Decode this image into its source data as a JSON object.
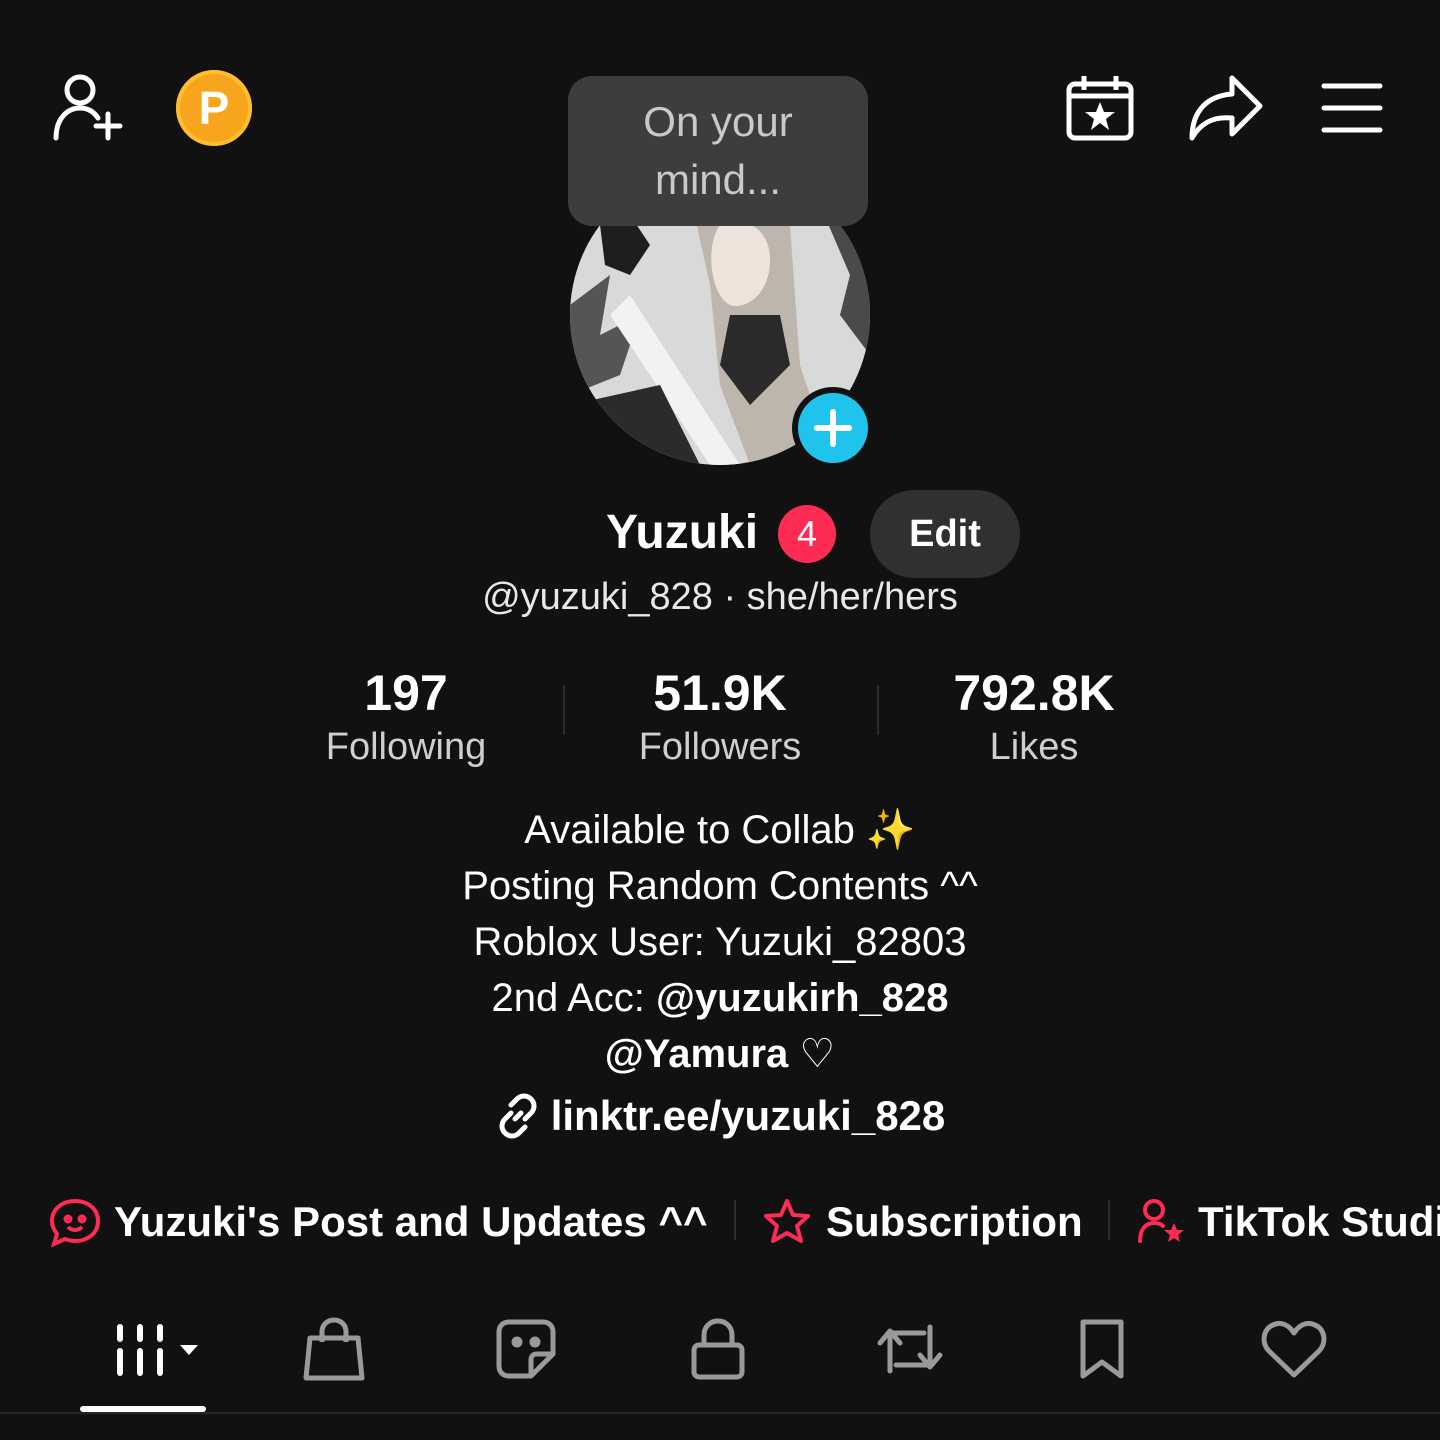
{
  "header": {
    "coin_letter": "P",
    "bubble_text": "On your mind..."
  },
  "profile": {
    "display_name": "Yuzuki",
    "badge_count": "4",
    "edit_label": "Edit",
    "handle_line": "@yuzuki_828 · she/her/hers"
  },
  "stats": [
    {
      "value": "197",
      "label": "Following"
    },
    {
      "value": "51.9K",
      "label": "Followers"
    },
    {
      "value": "792.8K",
      "label": "Likes"
    }
  ],
  "bio": {
    "line1": "Available to Collab ✨",
    "line2": "Posting Random Contents ^^",
    "line3": "Roblox User: Yuzuki_82803",
    "line4_prefix": "2nd Acc: ",
    "line4_mention": "@yuzukirh_828",
    "line5_mention": "@Yamura",
    "line5_suffix": " ♡",
    "link": "linktr.ee/yuzuki_828"
  },
  "chips": [
    {
      "label": "Yuzuki's Post and Updates ^^",
      "icon": "chat-bubble-icon"
    },
    {
      "label": "Subscription",
      "icon": "star-icon"
    },
    {
      "label": "TikTok Studi",
      "icon": "person-star-icon"
    }
  ],
  "tabs": [
    "grid-icon",
    "shopping-bag-icon",
    "sticker-icon",
    "lock-icon",
    "repost-icon",
    "bookmark-icon",
    "heart-icon"
  ],
  "colors": {
    "background": "#111111",
    "accent_red": "#fe2c55",
    "accent_cyan": "#20c3ec",
    "coin": "#f7a51c",
    "chip_icon": "#fe2c55"
  }
}
